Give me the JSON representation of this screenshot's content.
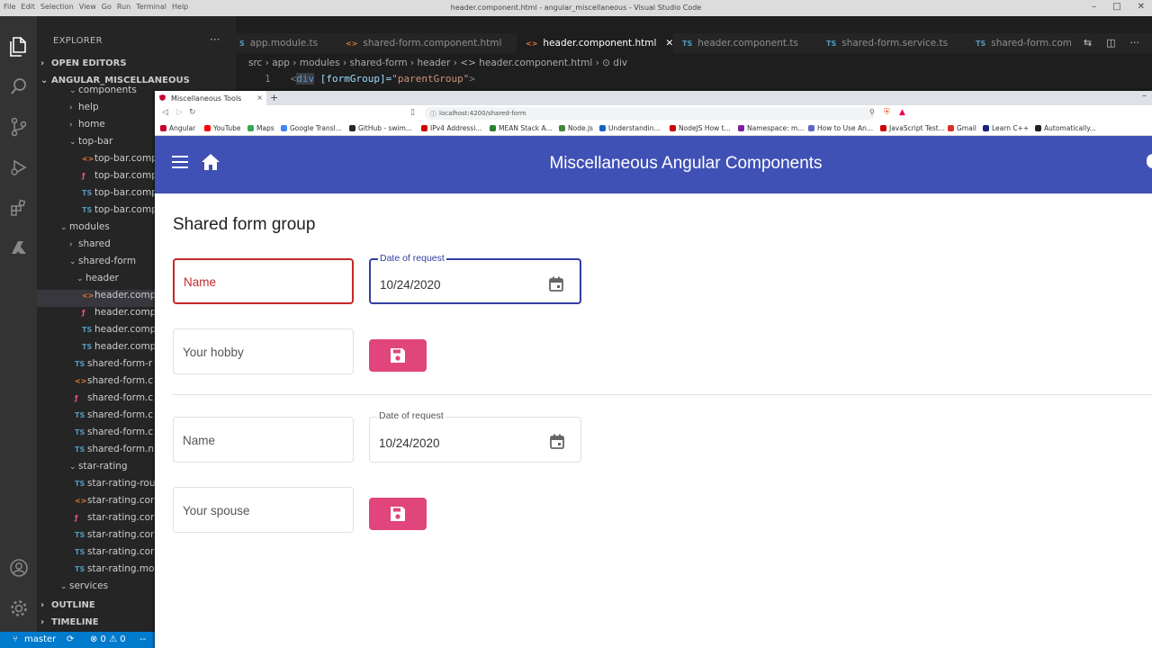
{
  "vscode": {
    "menu": [
      "File",
      "Edit",
      "Selection",
      "View",
      "Go",
      "Run",
      "Terminal",
      "Help"
    ],
    "window_title": "header.component.html - angular_miscellaneous - Visual Studio Code",
    "explorer_title": "EXPLORER",
    "more": "···",
    "sections": {
      "open_editors": "OPEN EDITORS",
      "project": "ANGULAR_MISCELLANEOUS",
      "outline": "OUTLINE",
      "timeline": "TIMELINE"
    },
    "tree": [
      {
        "label": "components",
        "chev": "⌄",
        "icon": ""
      },
      {
        "label": "help",
        "chev": "›",
        "icon": ""
      },
      {
        "label": "home",
        "chev": "›",
        "icon": ""
      },
      {
        "label": "top-bar",
        "chev": "⌄",
        "icon": ""
      },
      {
        "label": "top-bar.compo",
        "chev": "",
        "icon": "<>"
      },
      {
        "label": "top-bar.compo",
        "chev": "",
        "icon": "ƒ"
      },
      {
        "label": "top-bar.compo",
        "chev": "",
        "icon": "TS"
      },
      {
        "label": "top-bar.compo",
        "chev": "",
        "icon": "TS"
      },
      {
        "label": "modules",
        "chev": "⌄",
        "icon": ""
      },
      {
        "label": "shared",
        "chev": "›",
        "icon": ""
      },
      {
        "label": "shared-form",
        "chev": "⌄",
        "icon": ""
      },
      {
        "label": "header",
        "chev": "⌄",
        "icon": ""
      },
      {
        "label": "header.comp",
        "chev": "",
        "icon": "<>"
      },
      {
        "label": "header.comp",
        "chev": "",
        "icon": "ƒ"
      },
      {
        "label": "header.comp",
        "chev": "",
        "icon": "TS"
      },
      {
        "label": "header.comp",
        "chev": "",
        "icon": "TS"
      },
      {
        "label": "shared-form-r",
        "chev": "",
        "icon": "TS"
      },
      {
        "label": "shared-form.c",
        "chev": "",
        "icon": "<>"
      },
      {
        "label": "shared-form.c",
        "chev": "",
        "icon": "ƒ"
      },
      {
        "label": "shared-form.c",
        "chev": "",
        "icon": "TS"
      },
      {
        "label": "shared-form.c",
        "chev": "",
        "icon": "TS"
      },
      {
        "label": "shared-form.n",
        "chev": "",
        "icon": "TS"
      },
      {
        "label": "star-rating",
        "chev": "⌄",
        "icon": ""
      },
      {
        "label": "star-rating-rou",
        "chev": "",
        "icon": "TS"
      },
      {
        "label": "star-rating.cor",
        "chev": "",
        "icon": "<>"
      },
      {
        "label": "star-rating.cor",
        "chev": "",
        "icon": "ƒ"
      },
      {
        "label": "star-rating.cor",
        "chev": "",
        "icon": "TS"
      },
      {
        "label": "star-rating.cor",
        "chev": "",
        "icon": "TS"
      },
      {
        "label": "star-rating.mo",
        "chev": "",
        "icon": "TS"
      },
      {
        "label": "services",
        "chev": "⌄",
        "icon": ""
      }
    ],
    "tabs": [
      {
        "label": "app.module.ts",
        "icon": "S"
      },
      {
        "label": "shared-form.component.html",
        "icon": "<>"
      },
      {
        "label": "header.component.html",
        "icon": "<>",
        "close": "✕"
      },
      {
        "label": "header.component.ts",
        "icon": "TS"
      },
      {
        "label": "shared-form.service.ts",
        "icon": "TS"
      },
      {
        "label": "shared-form.comp",
        "icon": "TS"
      }
    ],
    "breadcrumb": "src › app › modules › shared-form › header › <> header.component.html › ⊙ div",
    "code": {
      "line_no": "1",
      "open": "<",
      "tag": "div",
      "attr": " [formGroup]=",
      "value": "\"parentGroup\"",
      "close": ">"
    },
    "status": {
      "branch": "master",
      "sync": "⟳",
      "problems": "⊗ 0 ⚠ 0",
      "extra": "--"
    }
  },
  "browser": {
    "tab_title": "Miscellaneous Tools",
    "tab_close": "×",
    "new_tab": "+",
    "minimize": "–",
    "url": "localhost:4200/shared-form",
    "bookmarks": [
      {
        "label": "Angular",
        "color": "#c3002f"
      },
      {
        "label": "YouTube",
        "color": "#ff0000"
      },
      {
        "label": "Maps",
        "color": "#34a853"
      },
      {
        "label": "Google Transl...",
        "color": "#4285f4"
      },
      {
        "label": "GitHub - swim...",
        "color": "#24292e"
      },
      {
        "label": "IPv4 Addressi...",
        "color": "#cc0000"
      },
      {
        "label": "MEAN Stack A...",
        "color": "#2e7d32"
      },
      {
        "label": "Node.js",
        "color": "#43853d"
      },
      {
        "label": "Understandin...",
        "color": "#1565c0"
      },
      {
        "label": "NodeJS How t...",
        "color": "#cc0000"
      },
      {
        "label": "Namespace: m...",
        "color": "#7b1fa2"
      },
      {
        "label": "How to Use An...",
        "color": "#5c6bc0"
      },
      {
        "label": "JavaScript Test...",
        "color": "#cc0000"
      },
      {
        "label": "Gmail",
        "color": "#d93025"
      },
      {
        "label": "Learn C++",
        "color": "#1a237e"
      },
      {
        "label": "Automatically...",
        "color": "#212121"
      }
    ]
  },
  "app": {
    "title": "Miscellaneous Angular Components",
    "heading": "Shared form group",
    "accent": "#3f51b5",
    "save_color": "#e0457b",
    "form1": {
      "name_placeholder": "Name",
      "date_label": "Date of request",
      "date_value": "10/24/2020",
      "hobby_placeholder": "Your hobby"
    },
    "form2": {
      "name_placeholder": "Name",
      "date_label": "Date of request",
      "date_value": "10/24/2020",
      "spouse_placeholder": "Your spouse"
    }
  }
}
